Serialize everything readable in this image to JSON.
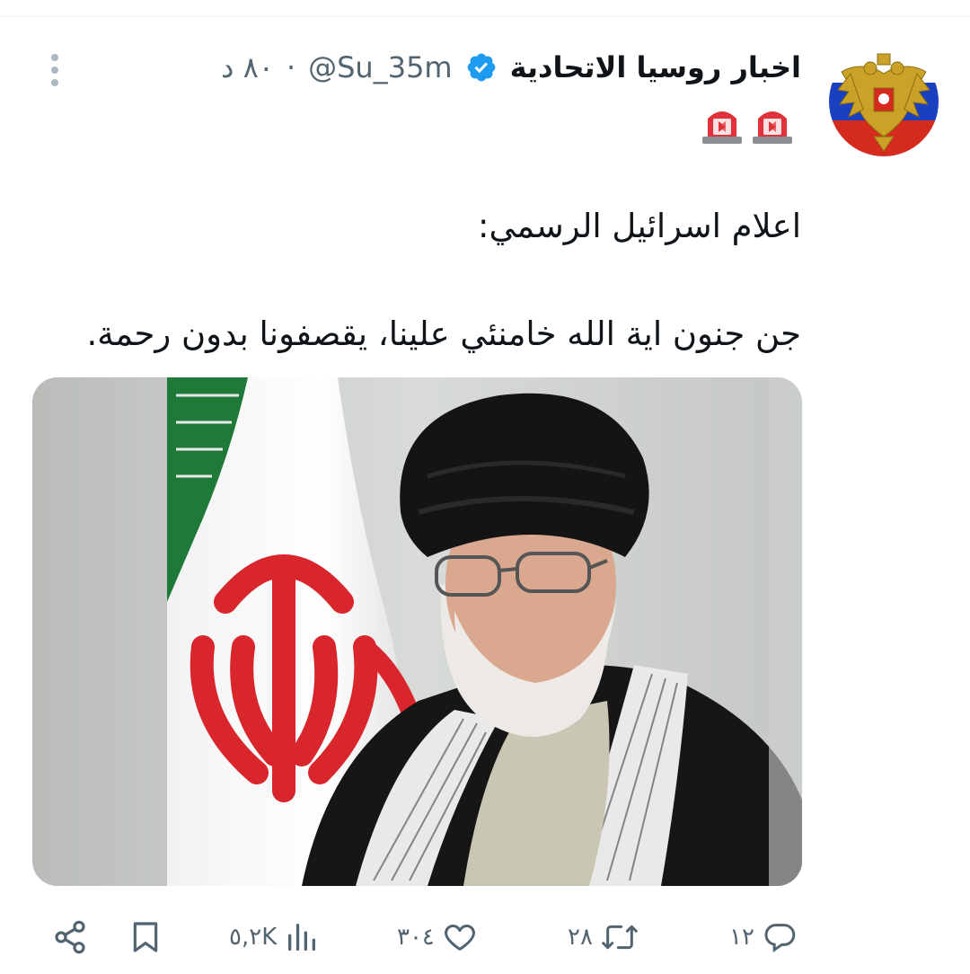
{
  "tweet": {
    "display_name": "اخبار روسيا الاتحادية",
    "handle": "@Su_35m",
    "separator": "·",
    "time": "٨٠ د",
    "alert_emojis": [
      "rotating-light-icon",
      "rotating-light-icon"
    ],
    "text_line1": "اعلام اسرائيل  الرسمي:",
    "text_line2": "جن جنون اية الله خامنئي علينا، يقصفونا بدون رحمة."
  },
  "actions": {
    "reply_count": "١٢",
    "retweet_count": "٢٨",
    "like_count": "٣٠٤",
    "views_count": "٥,٢K"
  },
  "colors": {
    "text_primary": "#0f1419",
    "text_secondary": "#536471",
    "verified": "#1d9bf0",
    "alert_red": "#e0323a"
  }
}
